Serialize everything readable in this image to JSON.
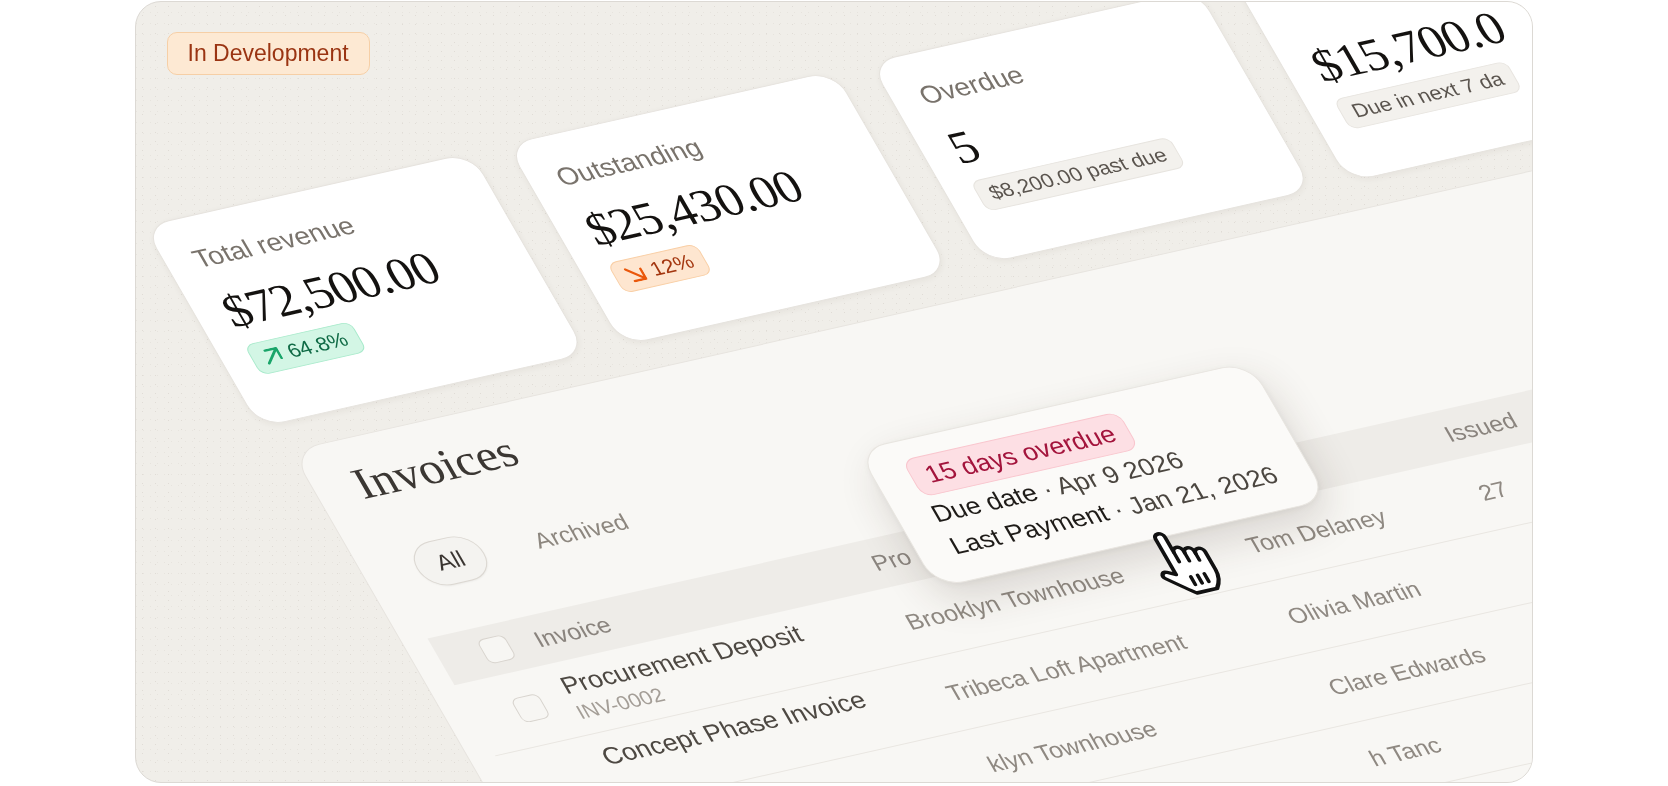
{
  "status_badge": {
    "label": "In Development"
  },
  "stat_cards": [
    {
      "title": "Total revenue",
      "value": "$72,500.00",
      "badge": {
        "kind": "up",
        "text": "64.8%"
      }
    },
    {
      "title": "Outstanding",
      "value": "$25,430.00",
      "badge": {
        "kind": "down",
        "text": "12%"
      }
    },
    {
      "title": "Overdue",
      "value": "5",
      "badge": {
        "kind": "neutral",
        "text": "$8,200.00 past due"
      }
    },
    {
      "value": "$15,700.0",
      "badge": {
        "kind": "neutral",
        "text": "Due in next 7 da"
      }
    }
  ],
  "invoices": {
    "title": "Invoices",
    "tabs": [
      {
        "label": "All",
        "selected": true
      },
      {
        "label": "Archived",
        "selected": false
      }
    ],
    "table": {
      "header": {
        "checked": false,
        "invoice": "Invoice",
        "column_2": "Pro",
        "issued": "Issued"
      },
      "rows": [
        {
          "checked": false,
          "invoice": {
            "name": "Procurement Deposit",
            "number": "INV-0002"
          },
          "column_2": "Brooklyn Townhouse",
          "column_3": "Tom Delaney",
          "issued": "27"
        },
        {
          "invoice": {
            "name": "Concept Phase Invoice"
          },
          "column_2": "Tribeca Loft Apartment",
          "column_3": "Olivia Martin"
        },
        {
          "column_2": "klyn Townhouse",
          "column_3": "Clare Edwards"
        },
        {
          "column_3": "h Tanc"
        }
      ]
    },
    "tooltip": {
      "badge": "15 days overdue",
      "lines": [
        {
          "label": "Due date",
          "separator": "·",
          "value": "Apr 9 2026"
        },
        {
          "label": "Last Payment",
          "separator": "·",
          "value": "Jan 21, 2026"
        }
      ]
    }
  }
}
